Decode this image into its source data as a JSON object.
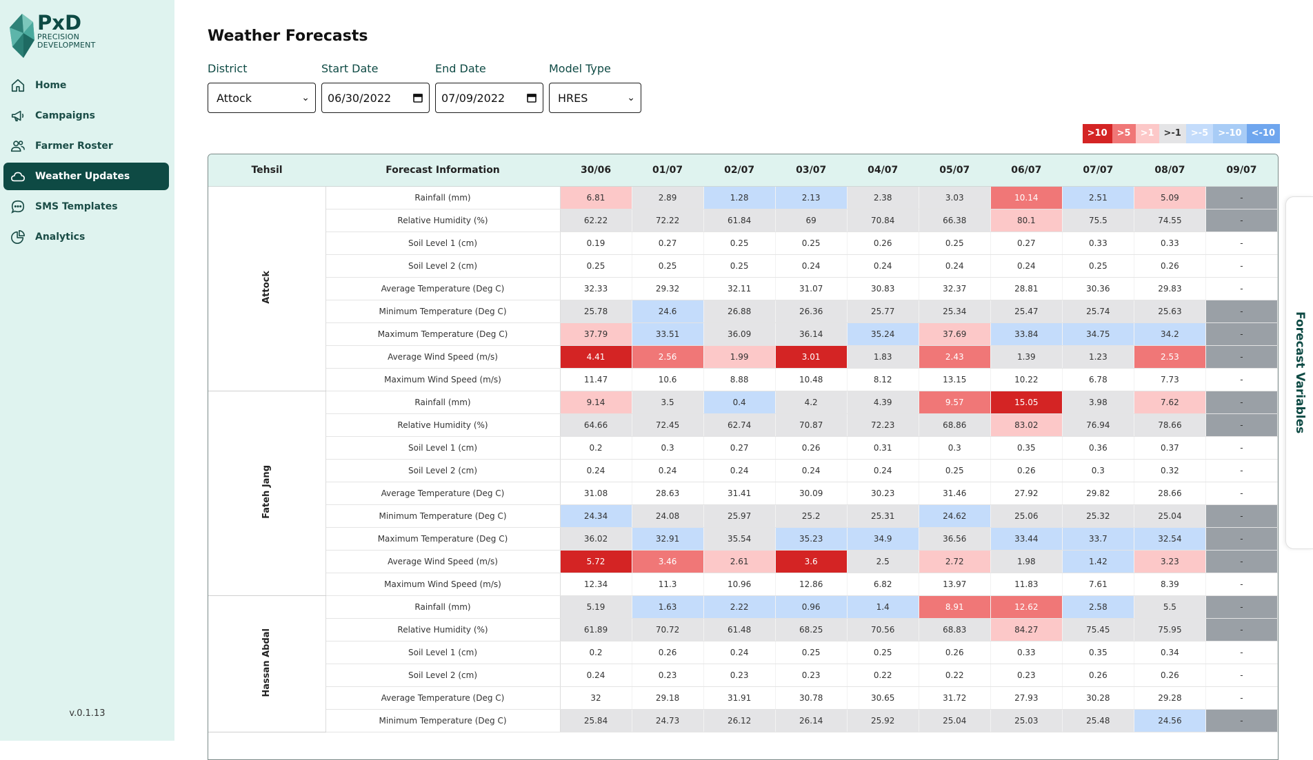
{
  "brand": {
    "name": "PxD",
    "line1": "PRECISION",
    "line2": "DEVELOPMENT",
    "color": "#0e4a44",
    "sidebar_bg": "#dff3ef"
  },
  "nav": [
    {
      "label": "Home",
      "icon": "home-icon",
      "active": false
    },
    {
      "label": "Campaigns",
      "icon": "megaphone-icon",
      "active": false
    },
    {
      "label": "Farmer Roster",
      "icon": "users-icon",
      "active": false
    },
    {
      "label": "Weather Updates",
      "icon": "cloud-icon",
      "active": true
    },
    {
      "label": "SMS Templates",
      "icon": "chat-icon",
      "active": false
    },
    {
      "label": "Analytics",
      "icon": "pie-chart-icon",
      "active": false
    }
  ],
  "version": "v.0.1.13",
  "page": {
    "title": "Weather Forecasts"
  },
  "filters": {
    "district": {
      "label": "District",
      "value": "Attock"
    },
    "start_date": {
      "label": "Start Date",
      "value": "06/30/2022"
    },
    "end_date": {
      "label": "End Date",
      "value": "07/09/2022"
    },
    "model_type": {
      "label": "Model Type",
      "value": "HRES"
    }
  },
  "legend": [
    {
      "label": ">10",
      "color": "#d42424"
    },
    {
      "label": ">5",
      "color": "#f07777"
    },
    {
      "label": ">1",
      "color": "#fcc8c8"
    },
    {
      "label": ">-1",
      "color": "#e4e4e6"
    },
    {
      "label": ">-5",
      "color": "#c4dcfb"
    },
    {
      "label": ">-10",
      "color": "#a8ccf6"
    },
    {
      "label": "<-10",
      "color": "#6fa6ee"
    }
  ],
  "table": {
    "headers": [
      "Tehsil",
      "Forecast Information",
      "30/06",
      "01/07",
      "02/07",
      "03/07",
      "04/07",
      "05/07",
      "06/07",
      "07/07",
      "08/07",
      "09/07"
    ],
    "groups": [
      {
        "tehsil": "Attock",
        "rows": [
          {
            "label": "Rainfall (mm)",
            "values": [
              "6.81",
              "2.89",
              "1.28",
              "2.13",
              "2.38",
              "3.03",
              "10.14",
              "2.51",
              "5.09",
              "-"
            ],
            "classes": [
              "r1",
              "n",
              "b1",
              "b1",
              "n",
              "n",
              "r2",
              "b1",
              "r1",
              "na"
            ]
          },
          {
            "label": "Relative Humidity (%)",
            "values": [
              "62.22",
              "72.22",
              "61.84",
              "69",
              "70.84",
              "66.38",
              "80.1",
              "75.5",
              "74.55",
              "-"
            ],
            "classes": [
              "n",
              "n",
              "n",
              "n",
              "n",
              "n",
              "r1",
              "n",
              "n",
              "na"
            ]
          },
          {
            "label": "Soil Level 1 (cm)",
            "values": [
              "0.19",
              "0.27",
              "0.25",
              "0.25",
              "0.26",
              "0.25",
              "0.27",
              "0.33",
              "0.33",
              "-"
            ],
            "classes": [
              "",
              "",
              "",
              "",
              "",
              "",
              "",
              "",
              "",
              ""
            ]
          },
          {
            "label": "Soil Level 2 (cm)",
            "values": [
              "0.25",
              "0.25",
              "0.25",
              "0.24",
              "0.24",
              "0.24",
              "0.24",
              "0.25",
              "0.26",
              "-"
            ],
            "classes": [
              "",
              "",
              "",
              "",
              "",
              "",
              "",
              "",
              "",
              ""
            ]
          },
          {
            "label": "Average Temperature (Deg C)",
            "values": [
              "32.33",
              "29.32",
              "32.11",
              "31.07",
              "30.83",
              "32.37",
              "28.81",
              "30.36",
              "29.83",
              "-"
            ],
            "classes": [
              "",
              "",
              "",
              "",
              "",
              "",
              "",
              "",
              "",
              ""
            ]
          },
          {
            "label": "Minimum Temperature (Deg C)",
            "values": [
              "25.78",
              "24.6",
              "26.88",
              "26.36",
              "25.77",
              "25.34",
              "25.47",
              "25.74",
              "25.63",
              "-"
            ],
            "classes": [
              "n",
              "b1",
              "n",
              "n",
              "n",
              "n",
              "n",
              "n",
              "n",
              "na"
            ]
          },
          {
            "label": "Maximum Temperature (Deg C)",
            "values": [
              "37.79",
              "33.51",
              "36.09",
              "36.14",
              "35.24",
              "37.69",
              "33.84",
              "34.75",
              "34.2",
              "-"
            ],
            "classes": [
              "r1",
              "b1",
              "n",
              "n",
              "b1",
              "r1",
              "b1",
              "b1",
              "b1",
              "na"
            ]
          },
          {
            "label": "Average Wind Speed (m/s)",
            "values": [
              "4.41",
              "2.56",
              "1.99",
              "3.01",
              "1.83",
              "2.43",
              "1.39",
              "1.23",
              "2.53",
              "-"
            ],
            "classes": [
              "r3",
              "r2",
              "r1",
              "r3",
              "n",
              "r2",
              "n",
              "n",
              "r2",
              "na"
            ]
          },
          {
            "label": "Maximum Wind Speed (m/s)",
            "values": [
              "11.47",
              "10.6",
              "8.88",
              "10.48",
              "8.12",
              "13.15",
              "10.22",
              "6.78",
              "7.73",
              "-"
            ],
            "classes": [
              "",
              "",
              "",
              "",
              "",
              "",
              "",
              "",
              "",
              ""
            ]
          }
        ]
      },
      {
        "tehsil": "Fateh Jang",
        "rows": [
          {
            "label": "Rainfall (mm)",
            "values": [
              "9.14",
              "3.5",
              "0.4",
              "4.2",
              "4.39",
              "9.57",
              "15.05",
              "3.98",
              "7.62",
              "-"
            ],
            "classes": [
              "r1",
              "n",
              "b1",
              "n",
              "n",
              "r2",
              "r3",
              "n",
              "r1",
              "na"
            ]
          },
          {
            "label": "Relative Humidity (%)",
            "values": [
              "64.66",
              "72.45",
              "62.74",
              "70.87",
              "72.23",
              "68.86",
              "83.02",
              "76.94",
              "78.66",
              "-"
            ],
            "classes": [
              "n",
              "n",
              "n",
              "n",
              "n",
              "n",
              "r1",
              "n",
              "n",
              "na"
            ]
          },
          {
            "label": "Soil Level 1 (cm)",
            "values": [
              "0.2",
              "0.3",
              "0.27",
              "0.26",
              "0.31",
              "0.3",
              "0.35",
              "0.36",
              "0.37",
              "-"
            ],
            "classes": [
              "",
              "",
              "",
              "",
              "",
              "",
              "",
              "",
              "",
              ""
            ]
          },
          {
            "label": "Soil Level 2 (cm)",
            "values": [
              "0.24",
              "0.24",
              "0.24",
              "0.24",
              "0.24",
              "0.25",
              "0.26",
              "0.3",
              "0.32",
              "-"
            ],
            "classes": [
              "",
              "",
              "",
              "",
              "",
              "",
              "",
              "",
              "",
              ""
            ]
          },
          {
            "label": "Average Temperature (Deg C)",
            "values": [
              "31.08",
              "28.63",
              "31.41",
              "30.09",
              "30.23",
              "31.46",
              "27.92",
              "29.82",
              "28.66",
              "-"
            ],
            "classes": [
              "",
              "",
              "",
              "",
              "",
              "",
              "",
              "",
              "",
              ""
            ]
          },
          {
            "label": "Minimum Temperature (Deg C)",
            "values": [
              "24.34",
              "24.08",
              "25.97",
              "25.2",
              "25.31",
              "24.62",
              "25.06",
              "25.32",
              "25.04",
              "-"
            ],
            "classes": [
              "b1",
              "n",
              "n",
              "n",
              "n",
              "b1",
              "n",
              "n",
              "n",
              "na"
            ]
          },
          {
            "label": "Maximum Temperature (Deg C)",
            "values": [
              "36.02",
              "32.91",
              "35.54",
              "35.23",
              "34.9",
              "36.56",
              "33.44",
              "33.7",
              "32.54",
              "-"
            ],
            "classes": [
              "n",
              "b1",
              "n",
              "b1",
              "b1",
              "n",
              "b1",
              "b1",
              "b1",
              "na"
            ]
          },
          {
            "label": "Average Wind Speed (m/s)",
            "values": [
              "5.72",
              "3.46",
              "2.61",
              "3.6",
              "2.5",
              "2.72",
              "1.98",
              "1.42",
              "3.23",
              "-"
            ],
            "classes": [
              "r3",
              "r2",
              "r1",
              "r3",
              "n",
              "r1",
              "n",
              "b1",
              "r1",
              "na"
            ]
          },
          {
            "label": "Maximum Wind Speed (m/s)",
            "values": [
              "12.34",
              "11.3",
              "10.96",
              "12.86",
              "6.82",
              "13.97",
              "11.83",
              "7.61",
              "8.39",
              "-"
            ],
            "classes": [
              "",
              "",
              "",
              "",
              "",
              "",
              "",
              "",
              "",
              ""
            ]
          }
        ]
      },
      {
        "tehsil": "Hassan Abdal",
        "rows": [
          {
            "label": "Rainfall (mm)",
            "values": [
              "5.19",
              "1.63",
              "2.22",
              "0.96",
              "1.4",
              "8.91",
              "12.62",
              "2.58",
              "5.5",
              "-"
            ],
            "classes": [
              "n",
              "b1",
              "b1",
              "b1",
              "b1",
              "r2",
              "r2",
              "b1",
              "n",
              "na"
            ]
          },
          {
            "label": "Relative Humidity (%)",
            "values": [
              "61.89",
              "70.72",
              "61.48",
              "68.25",
              "70.56",
              "68.83",
              "84.27",
              "75.45",
              "75.95",
              "-"
            ],
            "classes": [
              "n",
              "n",
              "n",
              "n",
              "n",
              "n",
              "r1",
              "n",
              "n",
              "na"
            ]
          },
          {
            "label": "Soil Level 1 (cm)",
            "values": [
              "0.2",
              "0.26",
              "0.24",
              "0.25",
              "0.25",
              "0.26",
              "0.33",
              "0.35",
              "0.34",
              "-"
            ],
            "classes": [
              "",
              "",
              "",
              "",
              "",
              "",
              "",
              "",
              "",
              ""
            ]
          },
          {
            "label": "Soil Level 2 (cm)",
            "values": [
              "0.24",
              "0.23",
              "0.23",
              "0.23",
              "0.22",
              "0.22",
              "0.23",
              "0.26",
              "0.26",
              "-"
            ],
            "classes": [
              "",
              "",
              "",
              "",
              "",
              "",
              "",
              "",
              "",
              ""
            ]
          },
          {
            "label": "Average Temperature (Deg C)",
            "values": [
              "32",
              "29.18",
              "31.91",
              "30.78",
              "30.65",
              "31.72",
              "27.93",
              "30.28",
              "29.28",
              "-"
            ],
            "classes": [
              "",
              "",
              "",
              "",
              "",
              "",
              "",
              "",
              "",
              ""
            ]
          },
          {
            "label": "Minimum Temperature (Deg C)",
            "values": [
              "25.84",
              "24.73",
              "26.12",
              "26.14",
              "25.92",
              "25.04",
              "25.03",
              "25.48",
              "24.56",
              "-"
            ],
            "classes": [
              "n",
              "n",
              "n",
              "n",
              "n",
              "n",
              "n",
              "n",
              "b1",
              "na"
            ]
          }
        ]
      }
    ]
  },
  "side_tab": {
    "label": "Forecast Variables"
  }
}
